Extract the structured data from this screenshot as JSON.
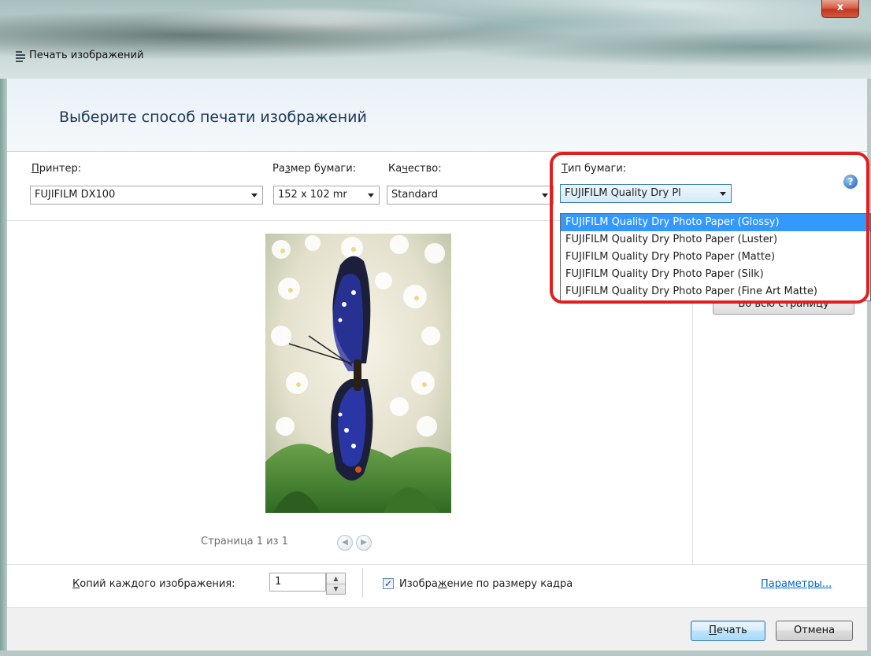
{
  "window": {
    "title": "Печать изображений",
    "close_label": "x"
  },
  "header": {
    "heading": "Выберите способ печати изображений"
  },
  "controls": {
    "printer": {
      "label_u": "П",
      "label_rest": "ринтер:",
      "value": "FUJIFILM DX100"
    },
    "paper_size": {
      "label_a": "Ра",
      "label_u": "з",
      "label_rest": "мер бумаги:",
      "value": "152 x 102 mr"
    },
    "quality": {
      "label_a": "Ка",
      "label_u": "ч",
      "label_rest": "ество:",
      "value": "Standard"
    },
    "paper_type": {
      "label_u": "Т",
      "label_rest": "ип бумаги:",
      "value": "FUJIFILM Quality Dry Pl"
    },
    "help_glyph": "?"
  },
  "paper_type_options": [
    "FUJIFILM Quality Dry Photo Paper (Glossy)",
    "FUJIFILM Quality Dry Photo Paper (Luster)",
    "FUJIFILM Quality Dry Photo Paper (Matte)",
    "FUJIFILM Quality Dry Photo Paper (Silk)",
    "FUJIFILM Quality Dry Photo Paper (Fine Art Matte)"
  ],
  "paper_type_selected_index": 0,
  "preview": {
    "page_indicator": "Страница 1 из 1",
    "prev_icon": "◀",
    "next_icon": "▶",
    "fit_button_label": "Во всю страницу"
  },
  "footer": {
    "copies_label_u": "К",
    "copies_label_rest": "опий каждого изображения:",
    "copies_value": "1",
    "fit_checkbox_checked": true,
    "fit_label_a": "Изобра",
    "fit_label_u": "ж",
    "fit_label_rest": "ение по размеру кадра",
    "options_link": "Параметры...",
    "print_u": "П",
    "print_rest": "ечать",
    "cancel_label": "Отмена"
  },
  "colors": {
    "heading": "#1e395b",
    "selection": "#3399ff",
    "highlight_outline": "#e02020",
    "link": "#0066cc"
  }
}
